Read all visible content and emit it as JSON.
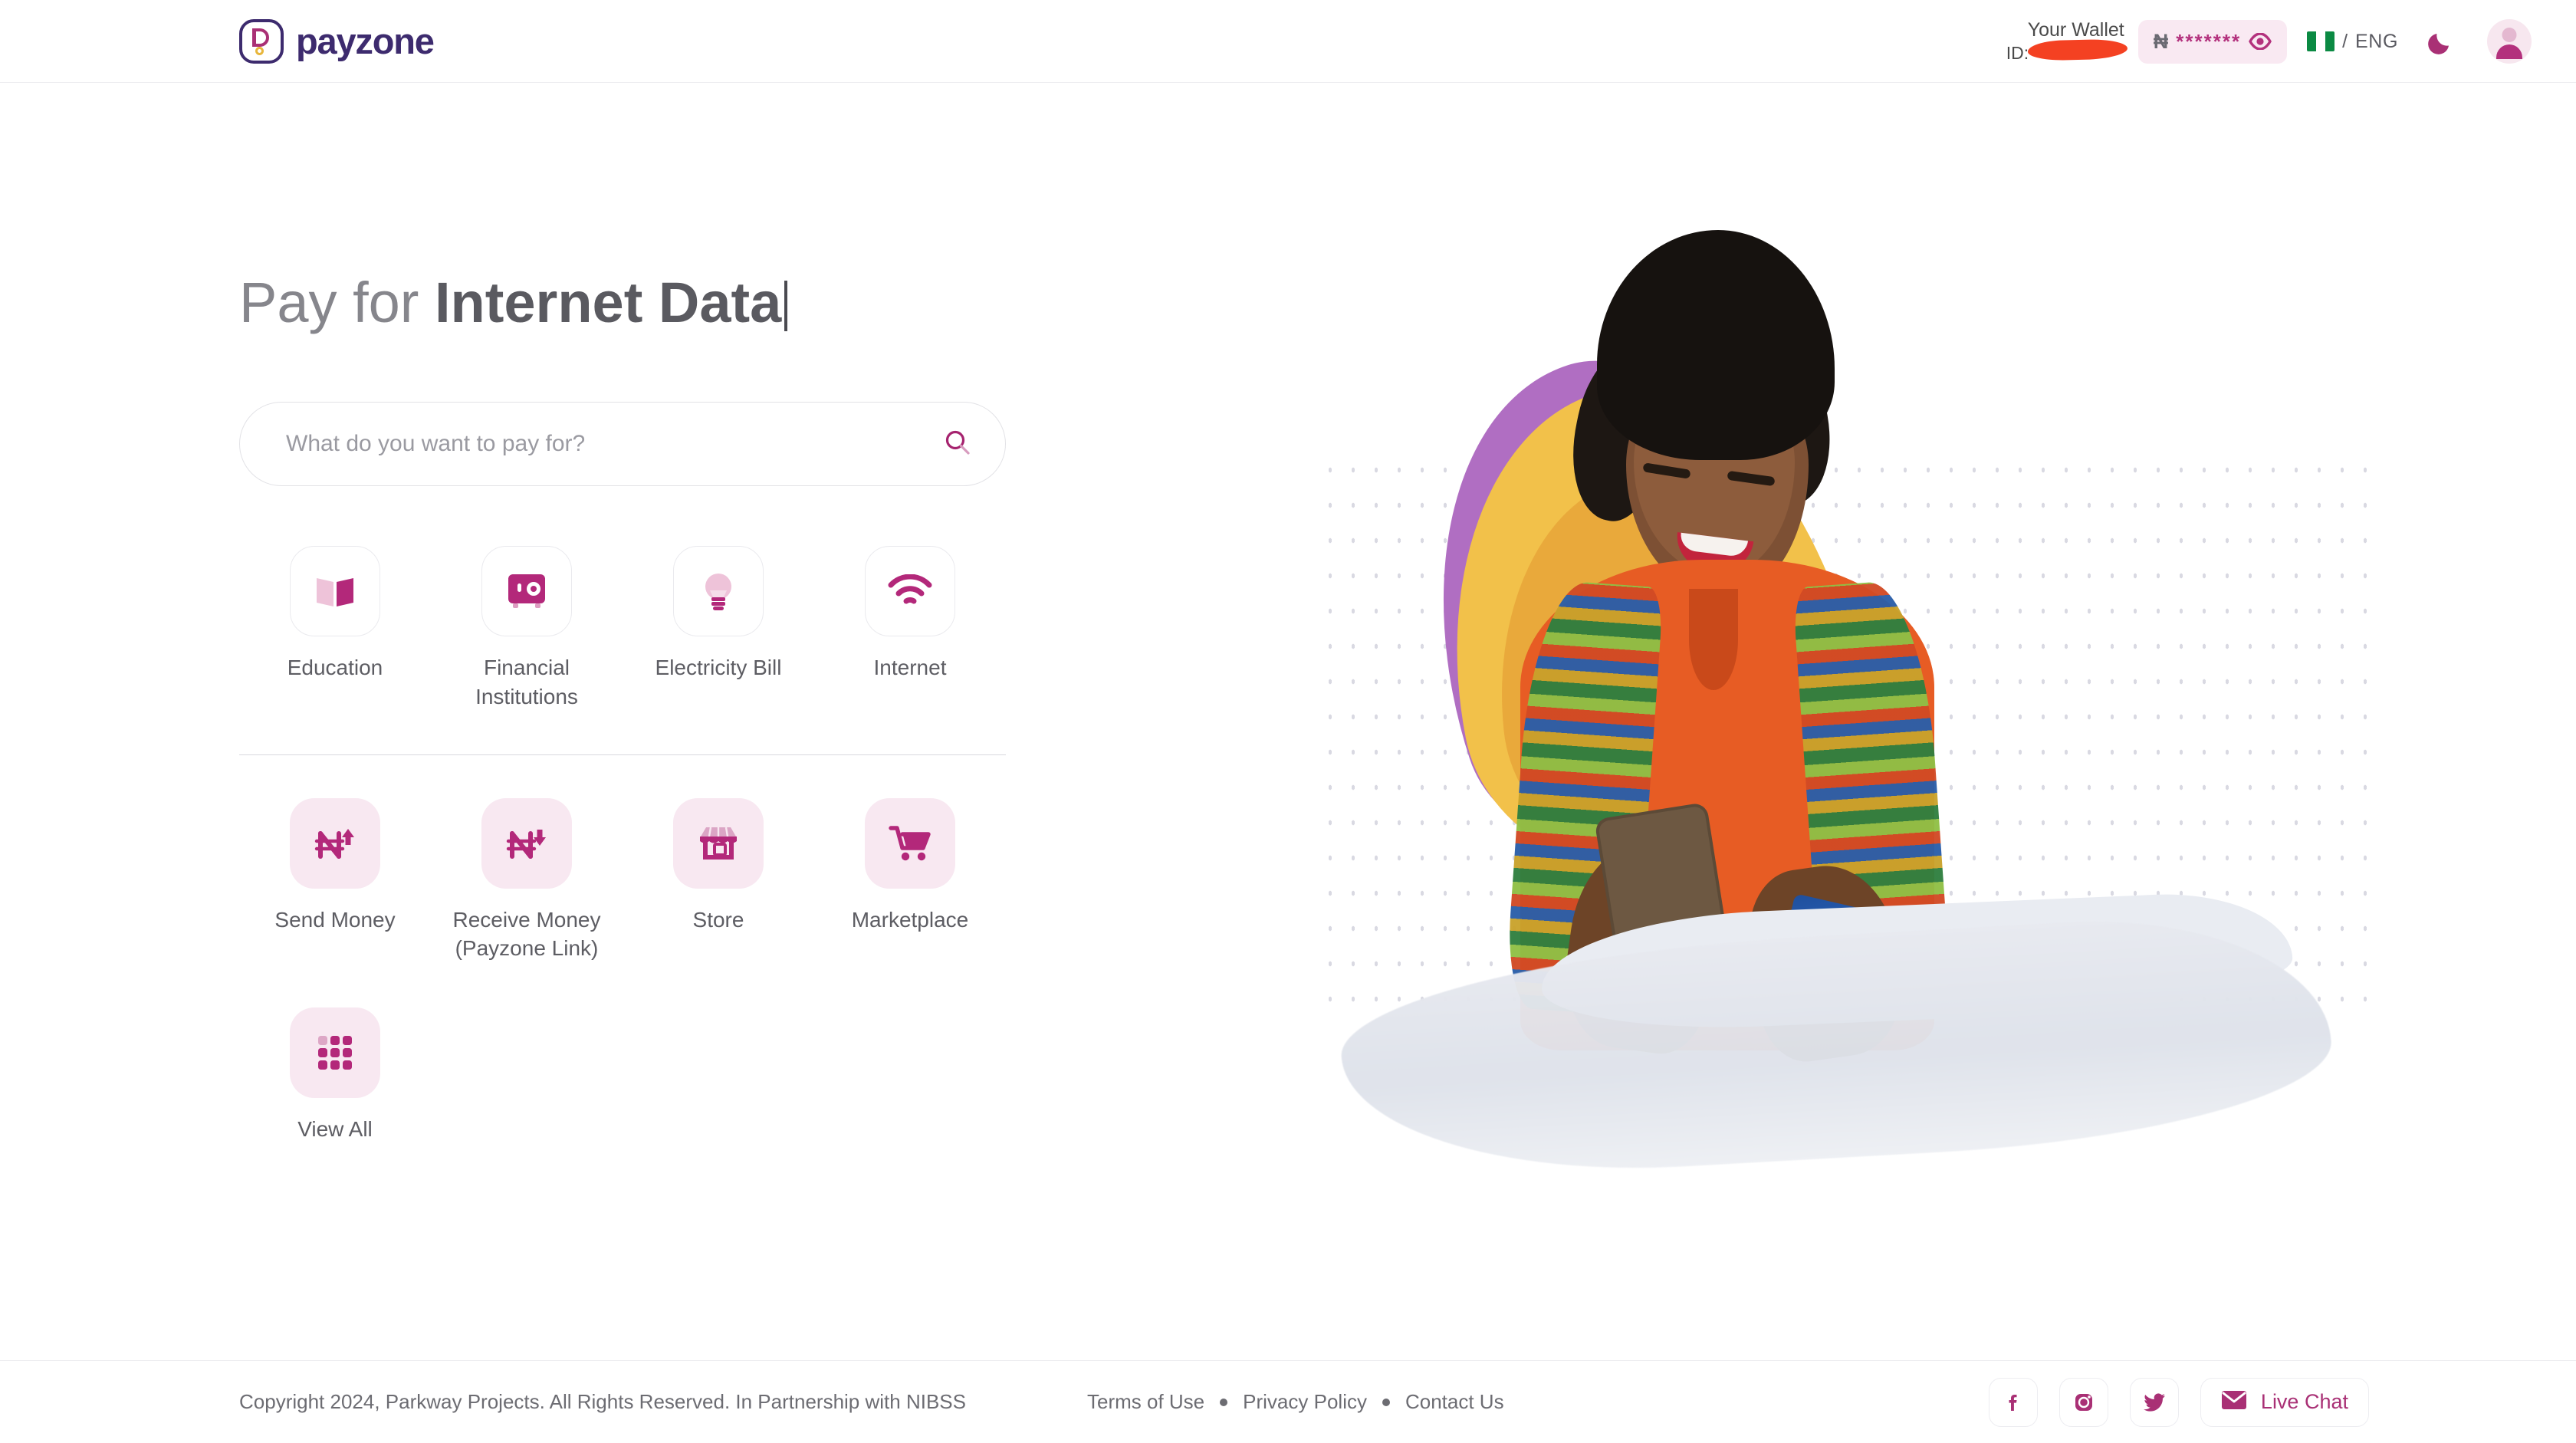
{
  "brand": {
    "name": "payzone",
    "logo_icon": "payzone-logo-icon",
    "primary_color": "#a93075",
    "dark_color": "#3d2b6e",
    "accent_gold": "#e8b63c"
  },
  "header": {
    "wallet_title": "Your Wallet",
    "wallet_id_label": "ID:",
    "wallet_id_value": "",
    "balance": {
      "currency_symbol": "₦",
      "masked_value": "*******",
      "toggle_icon": "eye-icon"
    },
    "language": {
      "flag": "nigeria-flag-icon",
      "separator": "/",
      "code": "ENG"
    },
    "theme_toggle_icon": "moon-icon",
    "avatar_icon": "user-avatar-icon"
  },
  "hero": {
    "headline_static": "Pay for ",
    "headline_typed": "Internet Data",
    "image_alt": "woman-with-phone-and-card-illustration"
  },
  "search": {
    "placeholder": "What do you want to pay for?",
    "value": "",
    "icon": "search-icon"
  },
  "services": {
    "row1": [
      {
        "label": "Education",
        "icon": "open-book-icon",
        "style": "outlined"
      },
      {
        "label": "Financial Institutions",
        "icon": "safe-vault-icon",
        "style": "outlined"
      },
      {
        "label": "Electricity Bill",
        "icon": "light-bulb-icon",
        "style": "outlined"
      },
      {
        "label": "Internet",
        "icon": "wifi-icon",
        "style": "outlined"
      }
    ],
    "row2": [
      {
        "label": "Send Money",
        "icon": "naira-up-arrow-icon",
        "style": "filled"
      },
      {
        "label": "Receive Money (Payzone Link)",
        "icon": "naira-down-arrow-icon",
        "style": "filled"
      },
      {
        "label": "Store",
        "icon": "storefront-icon",
        "style": "filled"
      },
      {
        "label": "Marketplace",
        "icon": "shopping-cart-icon",
        "style": "filled"
      }
    ],
    "row3": [
      {
        "label": "View All",
        "icon": "grid-dots-icon",
        "style": "filled"
      }
    ]
  },
  "footer": {
    "copyright": "Copyright 2024, Parkway Projects. All Rights Reserved. In Partnership with NIBSS",
    "links": [
      "Terms of Use",
      "Privacy Policy",
      "Contact Us"
    ],
    "social": [
      {
        "name": "facebook-icon"
      },
      {
        "name": "instagram-icon"
      },
      {
        "name": "twitter-icon"
      }
    ],
    "live_chat": {
      "label": "Live Chat",
      "icon": "envelope-icon"
    }
  }
}
